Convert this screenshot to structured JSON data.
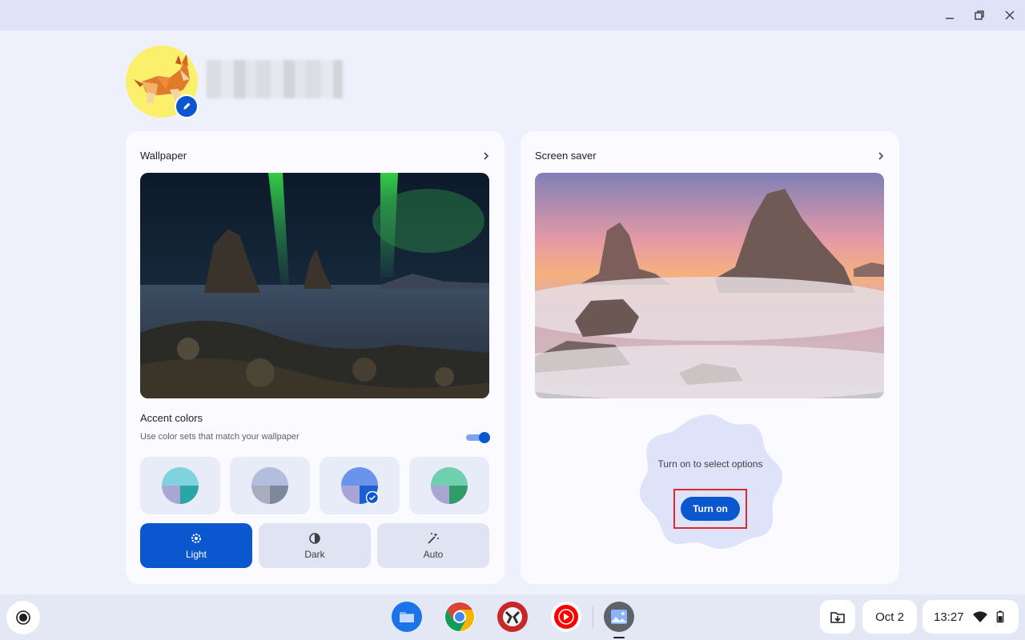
{
  "window": {
    "controls": [
      "minimize-icon",
      "restore-icon",
      "close-icon"
    ]
  },
  "wallpaper_card": {
    "title": "Wallpaper",
    "accent_title": "Accent colors",
    "accent_subtitle": "Use color sets that match your wallpaper",
    "accent_toggle_on": true,
    "swatches": [
      {
        "top": "#7fd3de",
        "left": "#aaa6d4",
        "right": "#2aa6a9"
      },
      {
        "top": "#b3bedf",
        "left": "#a9acbf",
        "right": "#7e889b"
      },
      {
        "top": "#6a93ec",
        "left": "#a9a4d6",
        "right": "#1b5fd4",
        "selected": true
      },
      {
        "top": "#6fcfae",
        "left": "#aaa6d4",
        "right": "#2f9c69"
      }
    ],
    "modes": [
      {
        "label": "Light",
        "icon": "gear-icon",
        "active": true
      },
      {
        "label": "Dark",
        "icon": "half-circle-icon",
        "active": false
      },
      {
        "label": "Auto",
        "icon": "magic-wand-icon",
        "active": false
      }
    ]
  },
  "screensaver_card": {
    "title": "Screen saver",
    "promo_text": "Turn on to select options",
    "turn_on_label": "Turn on"
  },
  "shelf": {
    "date": "Oct 2",
    "time": "13:27",
    "apps": [
      "files-app-icon",
      "chrome-icon",
      "game-app-icon",
      "youtube-music-icon",
      "wallpaper-app-icon"
    ]
  },
  "colors": {
    "accent": "#0b57d0",
    "background": "#eef0fb",
    "card": "#fbfaff"
  }
}
